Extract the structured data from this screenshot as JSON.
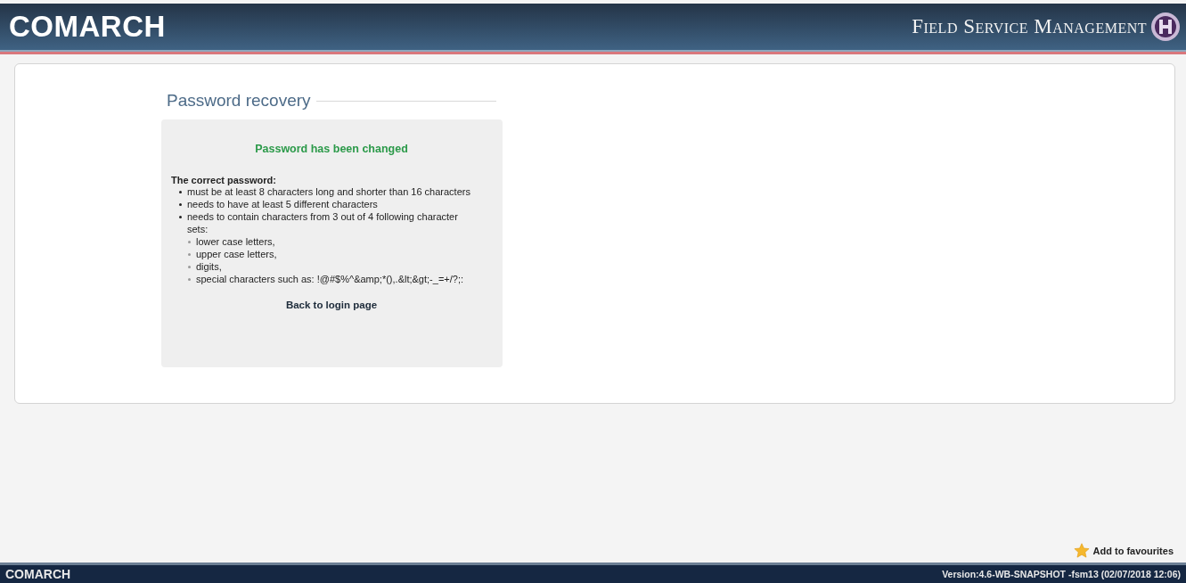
{
  "header": {
    "logo": "COMARCH",
    "product": "Field Service Management"
  },
  "section": {
    "title": "Password recovery"
  },
  "panel": {
    "message": "Password has been changed",
    "rules_title": "The correct password:",
    "rules": [
      {
        "text": "must be at least 8 characters long and shorter than 16 characters"
      },
      {
        "text": "needs to have at least 5 different characters"
      },
      {
        "text": "needs to contain characters from 3 out of 4 following character sets:",
        "children": [
          {
            "text": "lower case letters,"
          },
          {
            "text": "upper case letters,"
          },
          {
            "text": "digits,"
          },
          {
            "text": "special characters such as: !@#$%^&amp;*(),.&lt;&gt;-_=+/?;:"
          }
        ]
      }
    ],
    "link": "Back to login page"
  },
  "favourites": "Add to favourites",
  "footer": {
    "logo": "COMARCH",
    "version": "Version:4.6-WB-SNAPSHOT -fsm13 (02/07/2018 12:06)"
  }
}
